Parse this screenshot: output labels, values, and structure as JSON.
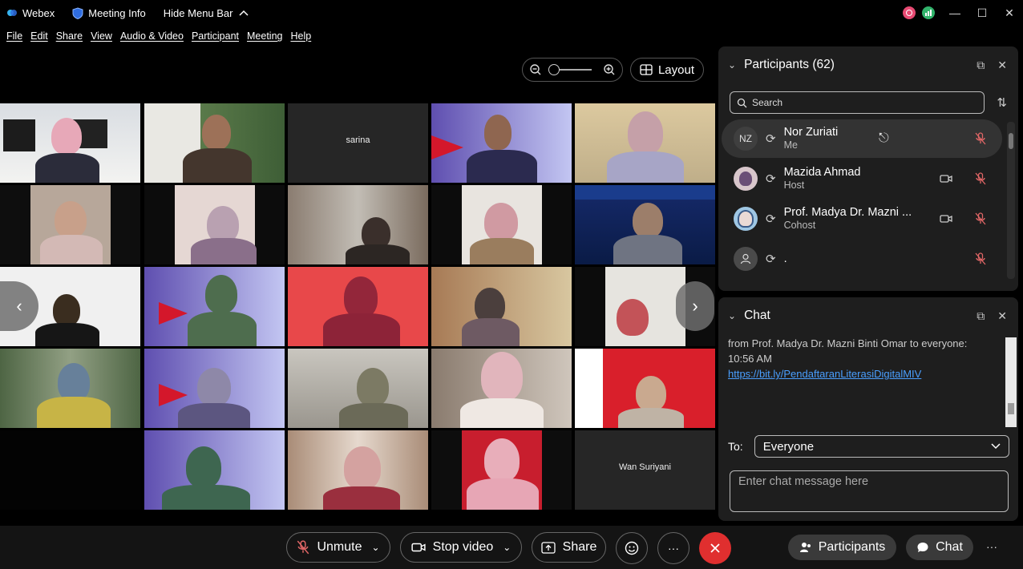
{
  "titlebar": {
    "app_name": "Webex",
    "meeting_info": "Meeting Info",
    "hide_menu": "Hide Menu Bar"
  },
  "menu": [
    "File",
    "Edit",
    "Share",
    "View",
    "Audio & Video",
    "Participant",
    "Meeting",
    "Help"
  ],
  "toolbar": {
    "layout_label": "Layout"
  },
  "video_tiles": [
    {
      "name": ""
    },
    {
      "name": ""
    },
    {
      "name": "sarina"
    },
    {
      "name": ""
    },
    {
      "name": ""
    },
    {
      "name": ""
    },
    {
      "name": ""
    },
    {
      "name": ""
    },
    {
      "name": ""
    },
    {
      "name": ""
    },
    {
      "name": ""
    },
    {
      "name": ""
    },
    {
      "name": ""
    },
    {
      "name": ""
    },
    {
      "name": ""
    },
    {
      "name": ""
    },
    {
      "name": ""
    },
    {
      "name": ""
    },
    {
      "name": ""
    },
    {
      "name": ""
    },
    {
      "name": ""
    },
    {
      "name": ""
    },
    {
      "name": ""
    },
    {
      "name": ""
    },
    {
      "name": "Wan Suriyani"
    }
  ],
  "participants_panel": {
    "title": "Participants (62)",
    "search_placeholder": "Search",
    "participants": [
      {
        "initials": "NZ",
        "name": "Nor Zuriati",
        "role": "Me",
        "muted": true,
        "video": false
      },
      {
        "initials": "",
        "name": "Mazida Ahmad",
        "role": "Host",
        "muted": true,
        "video": true
      },
      {
        "initials": "",
        "name": "Prof. Madya Dr. Mazni ...",
        "role": "Cohost",
        "muted": true,
        "video": true
      },
      {
        "initials": "",
        "name": ".",
        "role": "",
        "muted": true,
        "video": false
      }
    ]
  },
  "chat_panel": {
    "title": "Chat",
    "message_header": "from Prof. Madya Dr. Mazni Binti Omar to everyone:",
    "message_time": "10:56 AM",
    "message_link": "https://bit.ly/PendaftaranLiterasiDigitalMIV",
    "to_label": "To:",
    "to_value": "Everyone",
    "input_placeholder": "Enter chat message here"
  },
  "bottom_bar": {
    "unmute": "Unmute",
    "stop_video": "Stop video",
    "share": "Share",
    "participants": "Participants",
    "chat": "Chat",
    "more": "···"
  },
  "colors": {
    "end_call": "#e02f2f",
    "link": "#4a9fff",
    "muted_red": "#e06666",
    "panel_bg": "#1e1e1e"
  }
}
